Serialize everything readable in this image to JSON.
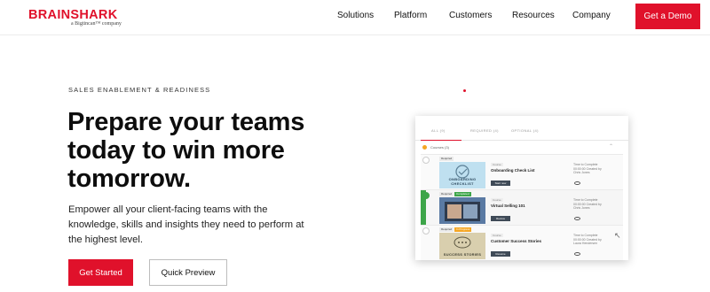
{
  "header": {
    "logo_text": "BRAINSHARK",
    "logo_tagline": "a Bigtincan™ company",
    "nav": [
      "Solutions",
      "Platform",
      "Customers",
      "Resources",
      "Company"
    ],
    "cta": "Get a Demo"
  },
  "hero": {
    "eyebrow": "SALES ENABLEMENT & READINESS",
    "headline": "Prepare your teams today to win more tomorrow.",
    "subcopy": "Empower all your client-facing teams with the knowledge, skills and insights they need to perform at the highest level.",
    "primary_button": "Get Started",
    "secondary_button": "Quick Preview"
  },
  "mock": {
    "tabs": [
      "ALL (9)",
      "REQUIRED (4)",
      "OPTIONAL (4)"
    ],
    "group_label": "Courses (3)",
    "courses": [
      {
        "tags": [
          "Required"
        ],
        "thumb_caption": "ONBOARDING CHECKLIST",
        "kind": "Course",
        "title": "Onboarding Check List",
        "action": "Start now",
        "meta": "Time to Complete 00:00:00 Created by Chris Jones"
      },
      {
        "tags": [
          "Required",
          "Completed"
        ],
        "thumb_caption": "",
        "kind": "Course",
        "title": "Virtual Selling 101",
        "action": "Review",
        "meta": "Time to Complete 00:00:00 Created by Chris Jones"
      },
      {
        "tags": [
          "Required",
          "In Progress"
        ],
        "thumb_caption": "SUCCESS STORIES",
        "kind": "Course",
        "title": "Customer Success Stories",
        "action": "Resume",
        "meta": "Time to Complete 00:00:00 Created by Laura Hendersen"
      }
    ]
  },
  "colors": {
    "brand_red": "#e0112b",
    "completed_green": "#3da549",
    "in_progress_orange": "#f5a623"
  }
}
